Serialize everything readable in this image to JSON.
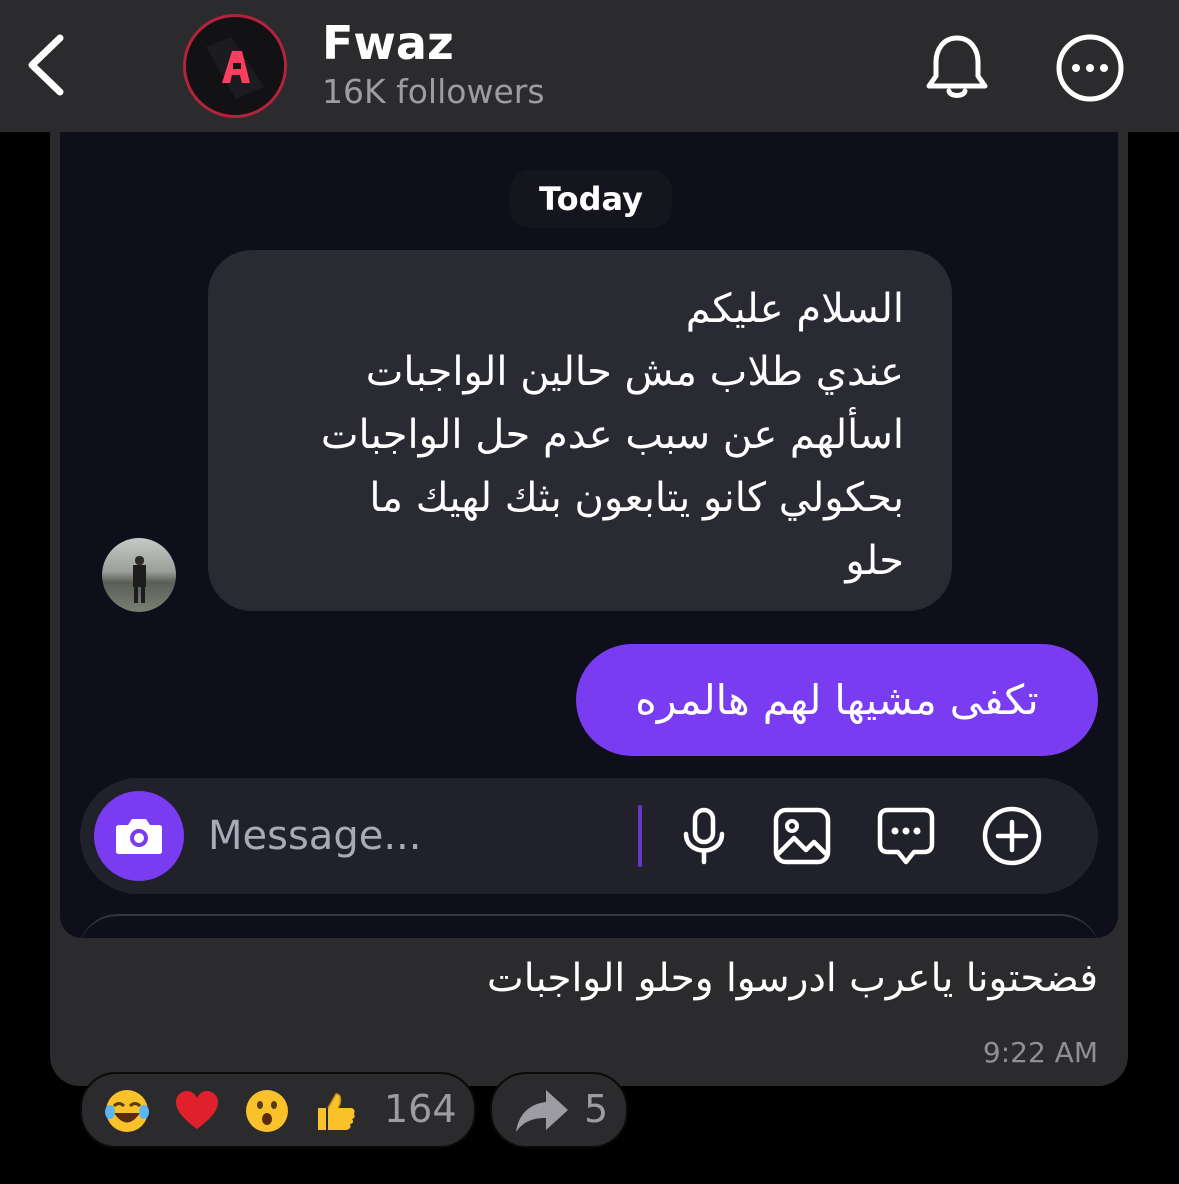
{
  "header": {
    "channel_name": "Fwaz",
    "followers": "16K followers",
    "brand_color": "#b3243c"
  },
  "conversation": {
    "date_chip": "Today",
    "incoming_text": "السلام عليكم\nعندي طلاب مش حالين الواجبات\nاسألهم عن سبب عدم حل الواجبات\nبحكولي كانو يتابعون بثك لهيك ما\nحلو",
    "outgoing_text": "تكفى مشيها لهم هالمره",
    "accent_color": "#7a3cf0"
  },
  "composer": {
    "placeholder": "Message..."
  },
  "post": {
    "caption": "فضحتونا ياعرب ادرسوا وحلو الواجبات",
    "time": "9:22 AM"
  },
  "reactions": {
    "emojis": [
      "face-with-tears-of-joy",
      "red-heart",
      "astonished-face",
      "thumbs-up"
    ],
    "count": "164"
  },
  "shares": {
    "count": "5"
  }
}
